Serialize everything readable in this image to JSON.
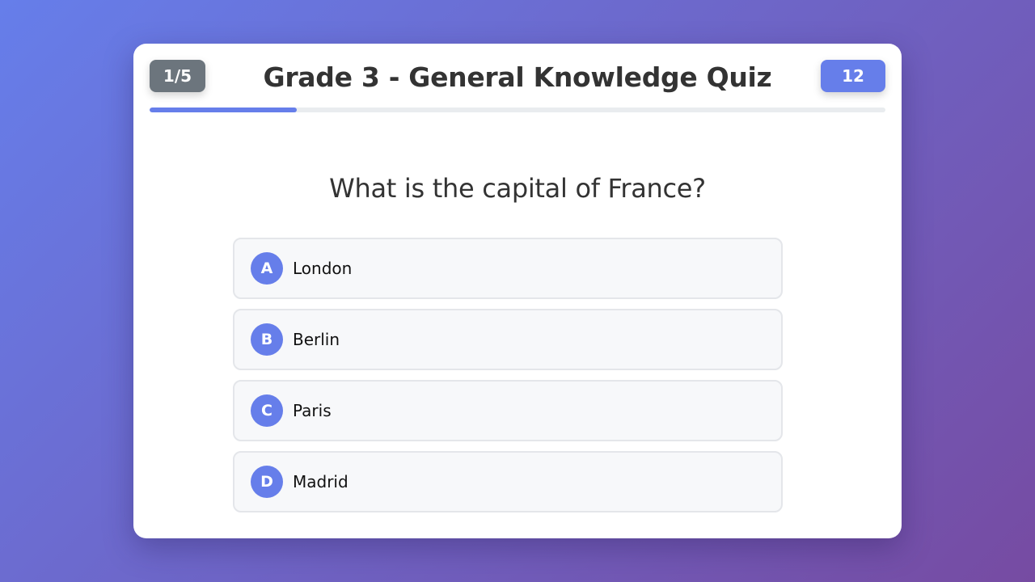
{
  "quiz": {
    "title": "Grade 3 - General Knowledge Quiz",
    "counter": "1/5",
    "timer": "12",
    "progress": 0.2
  },
  "question": {
    "text": "What is the capital of France?",
    "options": [
      {
        "letter": "A",
        "text": "London"
      },
      {
        "letter": "B",
        "text": "Berlin"
      },
      {
        "letter": "C",
        "text": "Paris"
      },
      {
        "letter": "D",
        "text": "Madrid"
      }
    ]
  },
  "colors": {
    "accent": "#667eea",
    "counter_bg": "#6c757d",
    "background_start": "#667eea",
    "background_end": "#764ba2"
  }
}
